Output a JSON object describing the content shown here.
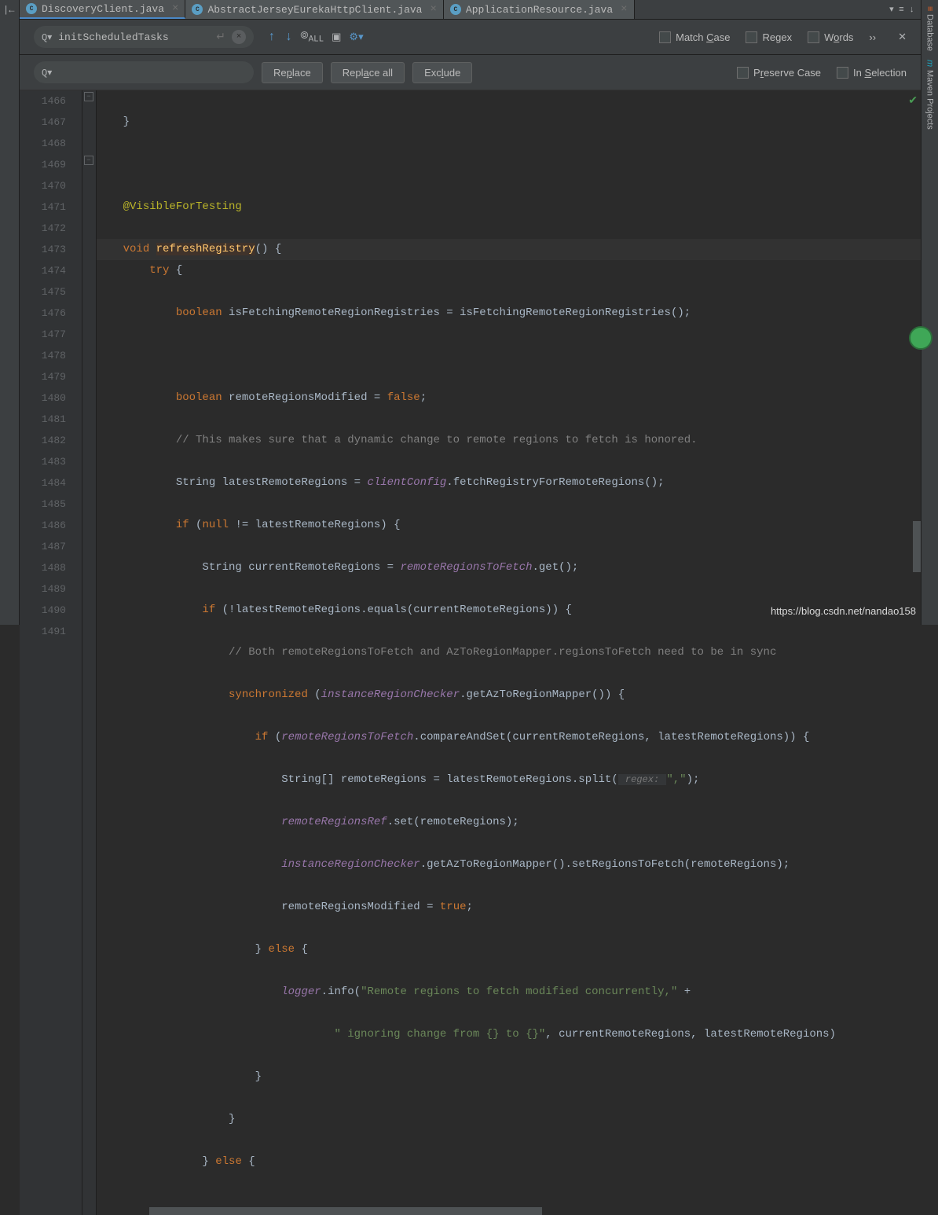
{
  "tabs": [
    {
      "label": "DiscoveryClient.java",
      "active": true
    },
    {
      "label": "AbstractJerseyEurekaHttpClient.java",
      "active": false
    },
    {
      "label": "ApplicationResource.java",
      "active": false
    }
  ],
  "find": {
    "query": "initScheduledTasks",
    "options": {
      "matchCase": "Match Case",
      "regex": "Regex",
      "words": "Words"
    }
  },
  "replace": {
    "query": "",
    "buttons": {
      "replace": "Replace",
      "replaceAll": "Replace all",
      "exclude": "Exclude"
    },
    "options": {
      "preserveCase": "Preserve Case",
      "inSelection": "In Selection"
    }
  },
  "lineNumbers": [
    "1466",
    "1467",
    "1468",
    "1469",
    "1470",
    "1471",
    "1472",
    "1473",
    "1474",
    "1475",
    "1476",
    "1477",
    "1478",
    "1479",
    "1480",
    "1481",
    "1482",
    "1483",
    "1484",
    "1485",
    "1486",
    "1487",
    "1488",
    "1489",
    "1490",
    "1491"
  ],
  "code": {
    "ann": "@VisibleForTesting",
    "l1469_void": "void",
    "l1469_name": "refreshRegistry",
    "l1470_try": "try",
    "l1471_bool": "boolean",
    "l1471_rest": "isFetchingRemoteRegionRegistries = isFetchingRemoteRegionRegistries();",
    "l1473_bool": "boolean",
    "l1473_var": "remoteRegionsModified = ",
    "l1473_false": "false",
    "l1474_com": "// This makes sure that a dynamic change to remote regions to fetch is honored.",
    "l1475_a": "String latestRemoteRegions = ",
    "l1475_b": "clientConfig",
    "l1475_c": ".fetchRegistryForRemoteRegions();",
    "l1476_if": "if",
    "l1476_null": "null",
    "l1476_rest": " != latestRemoteRegions) {",
    "l1477": "String currentRemoteRegions = ",
    "l1477_b": "remoteRegionsToFetch",
    "l1477_c": ".get();",
    "l1478_if": "if",
    "l1478_rest": " (!latestRemoteRegions.equals(currentRemoteRegions)) {",
    "l1479_com": "// Both remoteRegionsToFetch and AzToRegionMapper.regionsToFetch need to be in sync",
    "l1480_sync": "synchronized",
    "l1480_a": " (",
    "l1480_b": "instanceRegionChecker",
    "l1480_c": ".getAzToRegionMapper()) {",
    "l1481_if": "if",
    "l1481_a": " (",
    "l1481_b": "remoteRegionsToFetch",
    "l1481_c": ".compareAndSet(currentRemoteRegions, latestRemoteRegions)) {",
    "l1482_a": "String[] remoteRegions = latestRemoteRegions.split(",
    "l1482_hint": " regex: ",
    "l1482_str": "\",\"",
    "l1482_b": ");",
    "l1483_a": "remoteRegionsRef",
    "l1483_b": ".set(remoteRegions);",
    "l1484_a": "instanceRegionChecker",
    "l1484_b": ".getAzToRegionMapper().setRegionsToFetch(remoteRegions);",
    "l1485_a": "remoteRegionsModified = ",
    "l1485_true": "true",
    "l1486_a": "} ",
    "l1486_else": "else",
    "l1486_b": " {",
    "l1487_a": "logger",
    "l1487_b": ".info(",
    "l1487_str": "\"Remote regions to fetch modified concurrently,\"",
    "l1487_c": " +",
    "l1488_str": "\" ignoring change from {} to {}\"",
    "l1488_a": ", currentRemoteRegions, latestRemoteRegions)",
    "l1489": "}",
    "l1490": "}",
    "l1491_a": "} ",
    "l1491_else": "else",
    "l1491_b": " {"
  },
  "sidebar": {
    "database": "Database",
    "maven": "Maven Projects"
  },
  "watermark": "https://blog.csdn.net/nandao158"
}
